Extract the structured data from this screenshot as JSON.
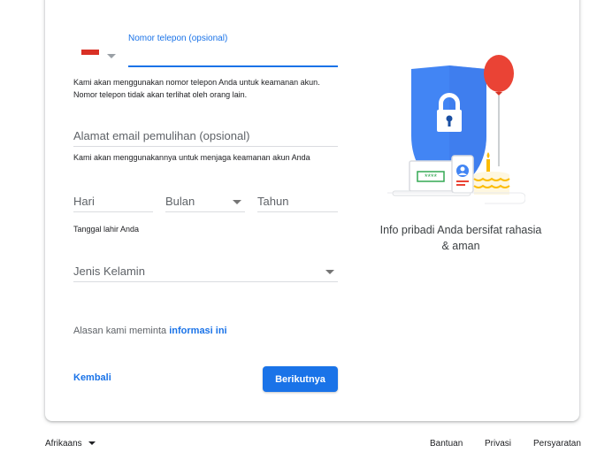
{
  "phone": {
    "label": "Nomor telepon (opsional)",
    "value": "",
    "helper_line1": "Kami akan menggunakan nomor telepon Anda untuk keamanan akun.",
    "helper_line2": "Nomor telepon tidak akan terlihat oleh orang lain."
  },
  "recovery_email": {
    "placeholder": "Alamat email pemulihan (opsional)",
    "helper": "Kami akan menggunakannya untuk menjaga keamanan akun Anda"
  },
  "birthday": {
    "day_placeholder": "Hari",
    "month_placeholder": "Bulan",
    "year_placeholder": "Tahun",
    "helper": "Tanggal lahir Anda"
  },
  "gender": {
    "placeholder": "Jenis Kelamin"
  },
  "why_info": {
    "prefix": "Alasan kami meminta ",
    "link": "informasi ini"
  },
  "buttons": {
    "back": "Kembali",
    "next": "Berikutnya"
  },
  "illustration": {
    "caption_line1": "Info pribadi Anda bersifat rahasia",
    "caption_line2": "& aman",
    "password_mask": "****"
  },
  "footer": {
    "language": "Afrikaans",
    "help": "Bantuan",
    "privacy": "Privasi",
    "terms": "Persyaratan"
  },
  "colors": {
    "accent": "#1a73e8",
    "shield": "#4285f4",
    "balloon": "#ea4335"
  }
}
